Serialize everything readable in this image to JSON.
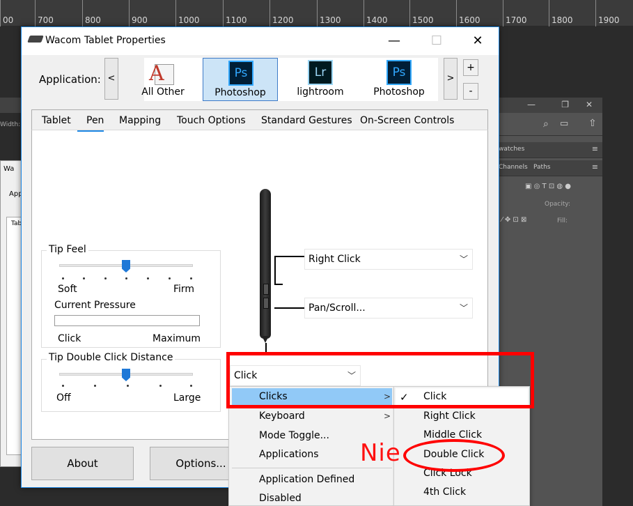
{
  "ruler": [
    "00",
    "700",
    "800",
    "900",
    "1000",
    "1100",
    "1200",
    "1300",
    "1400",
    "1500",
    "1600",
    "1700",
    "1800",
    "1900"
  ],
  "window": {
    "title": "Wacom Tablet Properties",
    "minimize": "—",
    "maximize": "☐",
    "close": "✕"
  },
  "application": {
    "label": "Application:",
    "prev": "<",
    "next": ">",
    "add": "+",
    "remove": "-",
    "items": [
      {
        "name": "All Other",
        "icon": "all-other-icon"
      },
      {
        "name": "Photoshop",
        "icon": "ps-icon",
        "glyph": "Ps",
        "selected": true
      },
      {
        "name": "lightroom",
        "icon": "lr-icon",
        "glyph": "Lr"
      },
      {
        "name": "Photoshop",
        "icon": "ps-icon",
        "glyph": "Ps"
      }
    ]
  },
  "tabs": [
    "Tablet",
    "Pen",
    "Mapping",
    "Touch Options",
    "Standard Gestures",
    "On-Screen Controls"
  ],
  "active_tab": "Pen",
  "tip_feel": {
    "title": "Tip Feel",
    "min": "Soft",
    "max": "Firm",
    "value": 0.5,
    "pressure_label": "Current Pressure",
    "pressure_min": "Click",
    "pressure_max": "Maximum"
  },
  "tip_double": {
    "title": "Tip Double Click Distance",
    "min": "Off",
    "max": "Large",
    "value": 0.5
  },
  "pen_buttons": {
    "upper": "Right Click",
    "lower": "Pan/Scroll...",
    "tip": "Click"
  },
  "buttons": {
    "about": "About",
    "options": "Options..."
  },
  "menu": {
    "items": [
      "Clicks",
      "Keyboard",
      "Mode Toggle...",
      "Applications",
      "Application Defined",
      "Disabled"
    ],
    "submenu_arrow": ">"
  },
  "submenu": {
    "items": [
      "Click",
      "Right Click",
      "Middle Click",
      "Double Click",
      "Click Lock",
      "4th Click"
    ],
    "checked": "Click",
    "check": "✓"
  },
  "annotation": {
    "text": "Nie"
  },
  "ps_panel": {
    "swatches": "watches",
    "channels": "Channels",
    "paths": "Paths",
    "opacity": "Opacity:",
    "fill": "Fill:",
    "width": "Width:"
  },
  "left_window": {
    "title": "Wa",
    "app": "App",
    "tab": "Tab"
  }
}
